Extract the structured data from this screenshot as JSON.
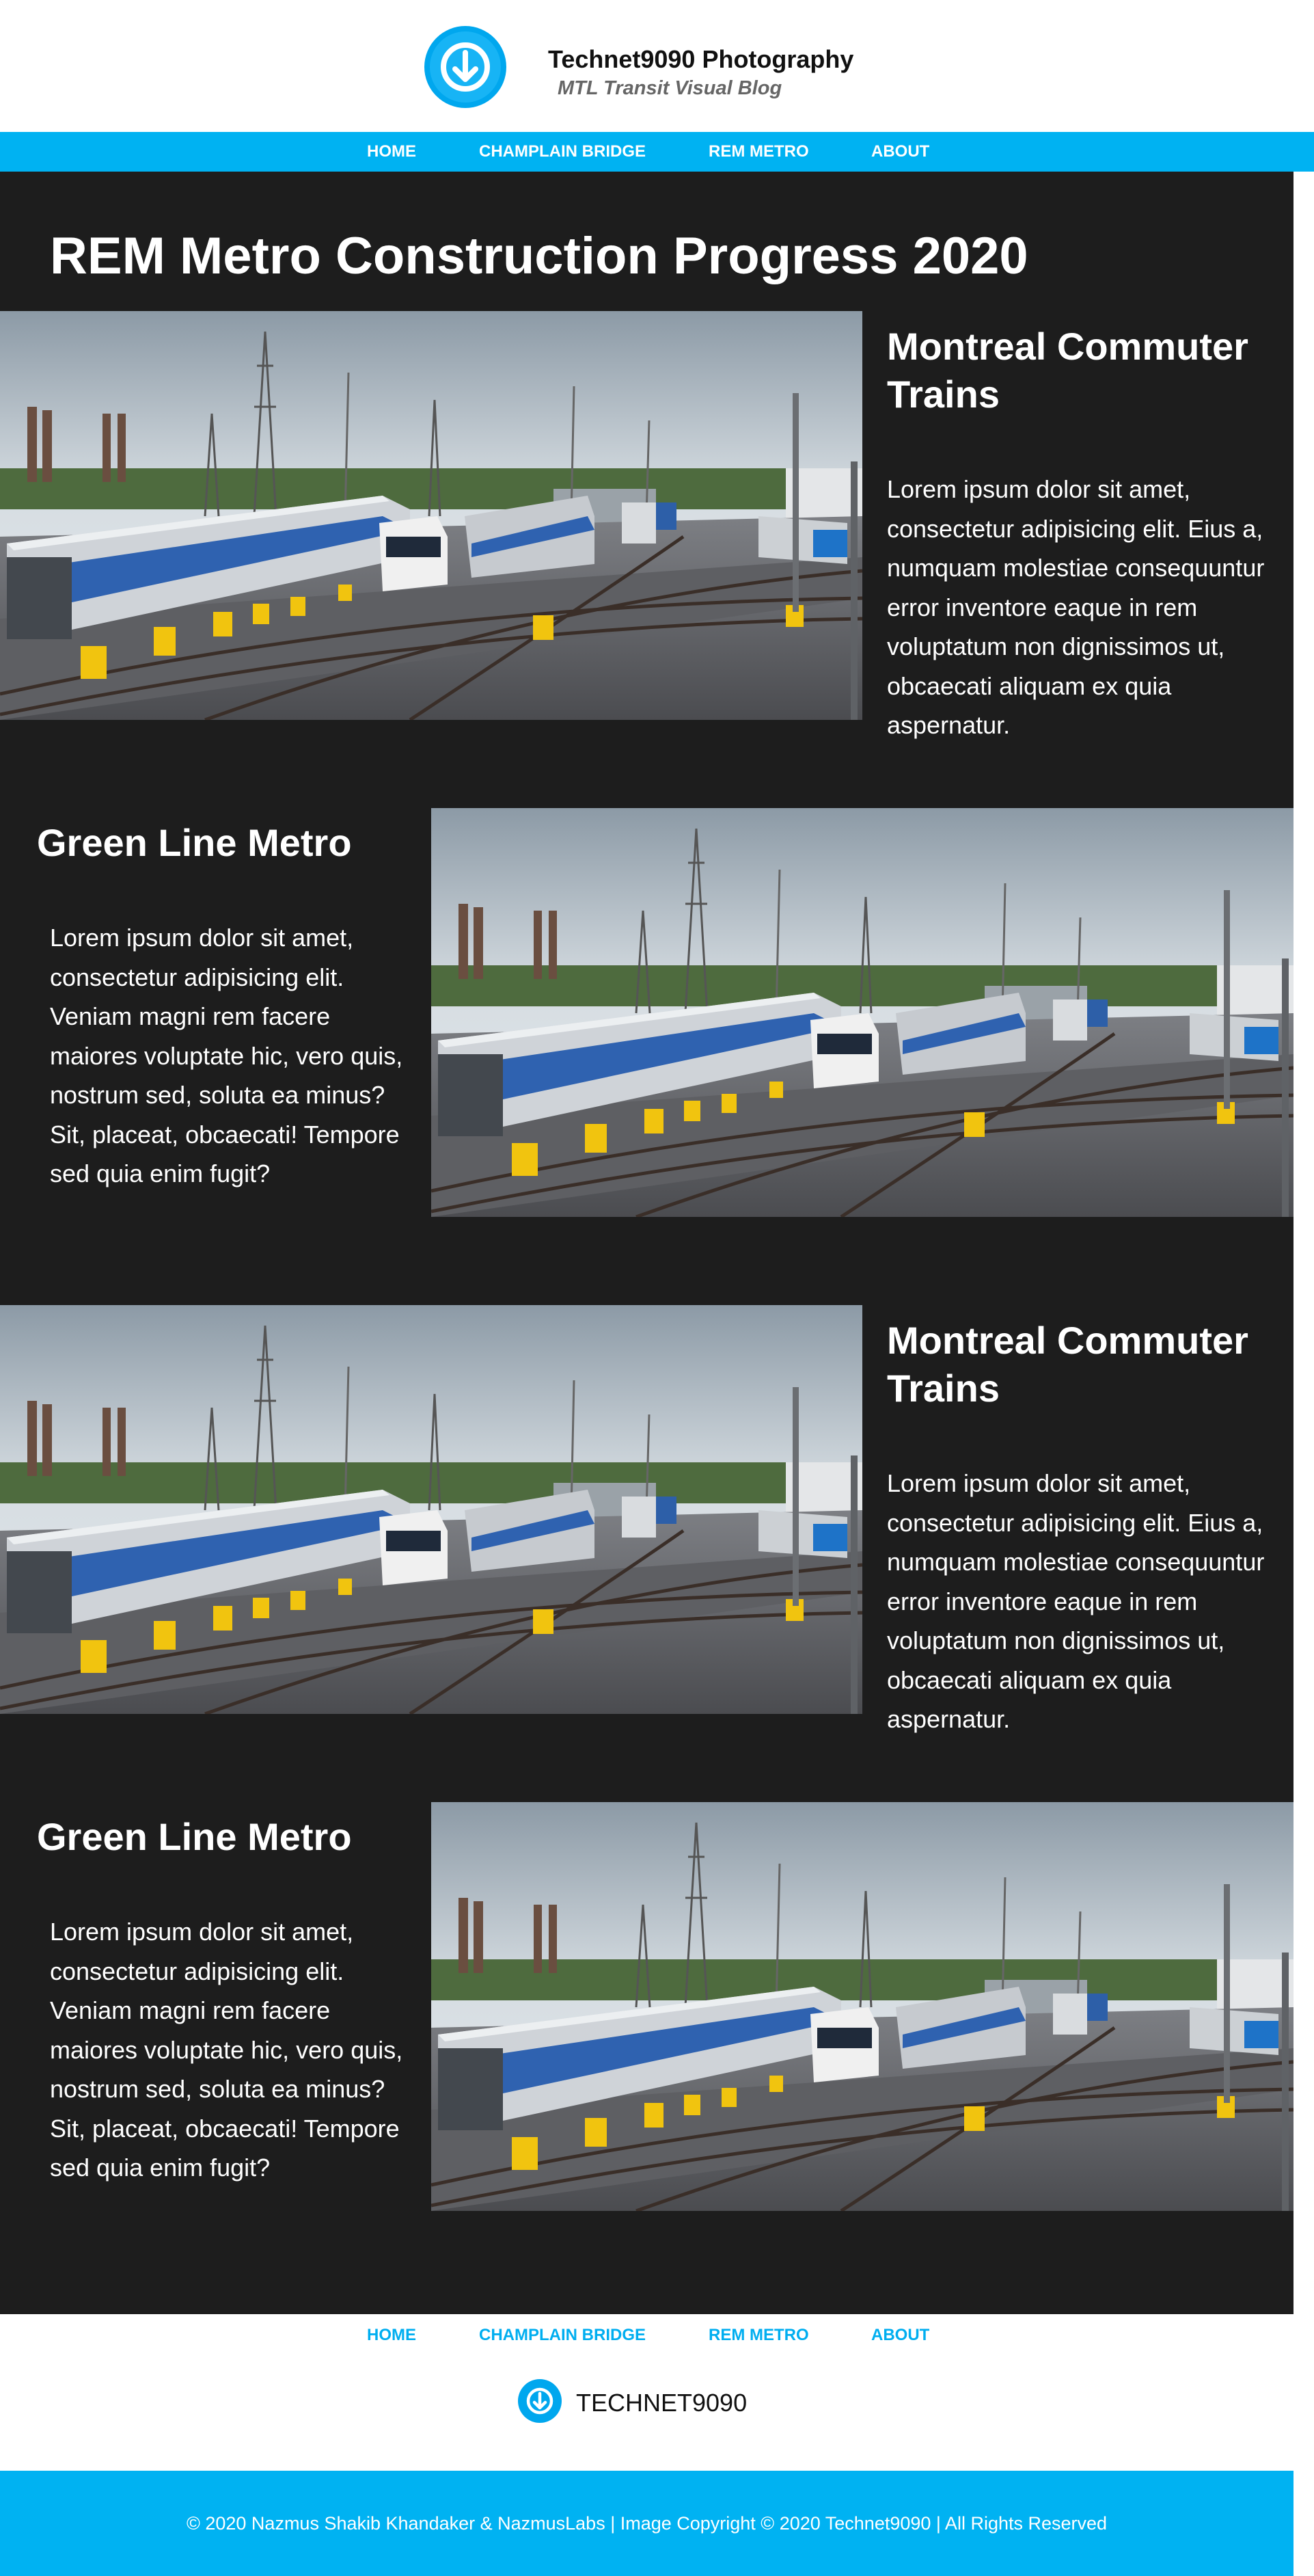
{
  "header": {
    "title": "Technet9090 Photography",
    "subtitle": "MTL Transit Visual Blog",
    "logo_icon": "down-arrow-circle-icon"
  },
  "nav": {
    "items": [
      {
        "label": "HOME"
      },
      {
        "label": "CHAMPLAIN BRIDGE"
      },
      {
        "label": "REM METRO"
      },
      {
        "label": "ABOUT"
      }
    ]
  },
  "main": {
    "page_title": "REM Metro Construction Progress 2020",
    "sections": [
      {
        "heading": "Montreal Commuter Trains",
        "body": "Lorem ipsum dolor sit amet, consectetur adipisicing elit. Eius a, numquam molestiae consequuntur error inventore eaque in rem voluptatum non dignissimos ut, obcaecati aliquam ex quia aspernatur."
      },
      {
        "heading": "Green Line Metro",
        "body": "Lorem ipsum dolor sit amet, consectetur adipisicing elit. Veniam magni rem facere maiores voluptate hic, vero quis, nostrum sed, soluta ea minus? Sit, placeat, obcaecati! Tempore sed quia enim fugit?"
      },
      {
        "heading": "Montreal Commuter Trains",
        "body": "Lorem ipsum dolor sit amet, consectetur adipisicing elit. Eius a, numquam molestiae consequuntur error inventore eaque in rem voluptatum non dignissimos ut, obcaecati aliquam ex quia aspernatur."
      },
      {
        "heading": "Green Line Metro",
        "body": "Lorem ipsum dolor sit amet, consectetur adipisicing elit. Veniam magni rem facere maiores voluptate hic, vero quis, nostrum sed, soluta ea minus? Sit, placeat, obcaecati! Tempore sed quia enim fugit?"
      }
    ]
  },
  "footer": {
    "nav": [
      {
        "label": "HOME"
      },
      {
        "label": "CHAMPLAIN BRIDGE"
      },
      {
        "label": "REM METRO"
      },
      {
        "label": "ABOUT"
      }
    ],
    "brand": "TECHNET9090",
    "copyright": "© 2020 Nazmus Shakib Khandaker & NazmusLabs | Image Copyright © 2020 Technet9090 | All Rights Reserved"
  },
  "colors": {
    "accent": "#00b2f2",
    "content_background": "#1d1d1d",
    "footer_link": "#00aef0"
  }
}
